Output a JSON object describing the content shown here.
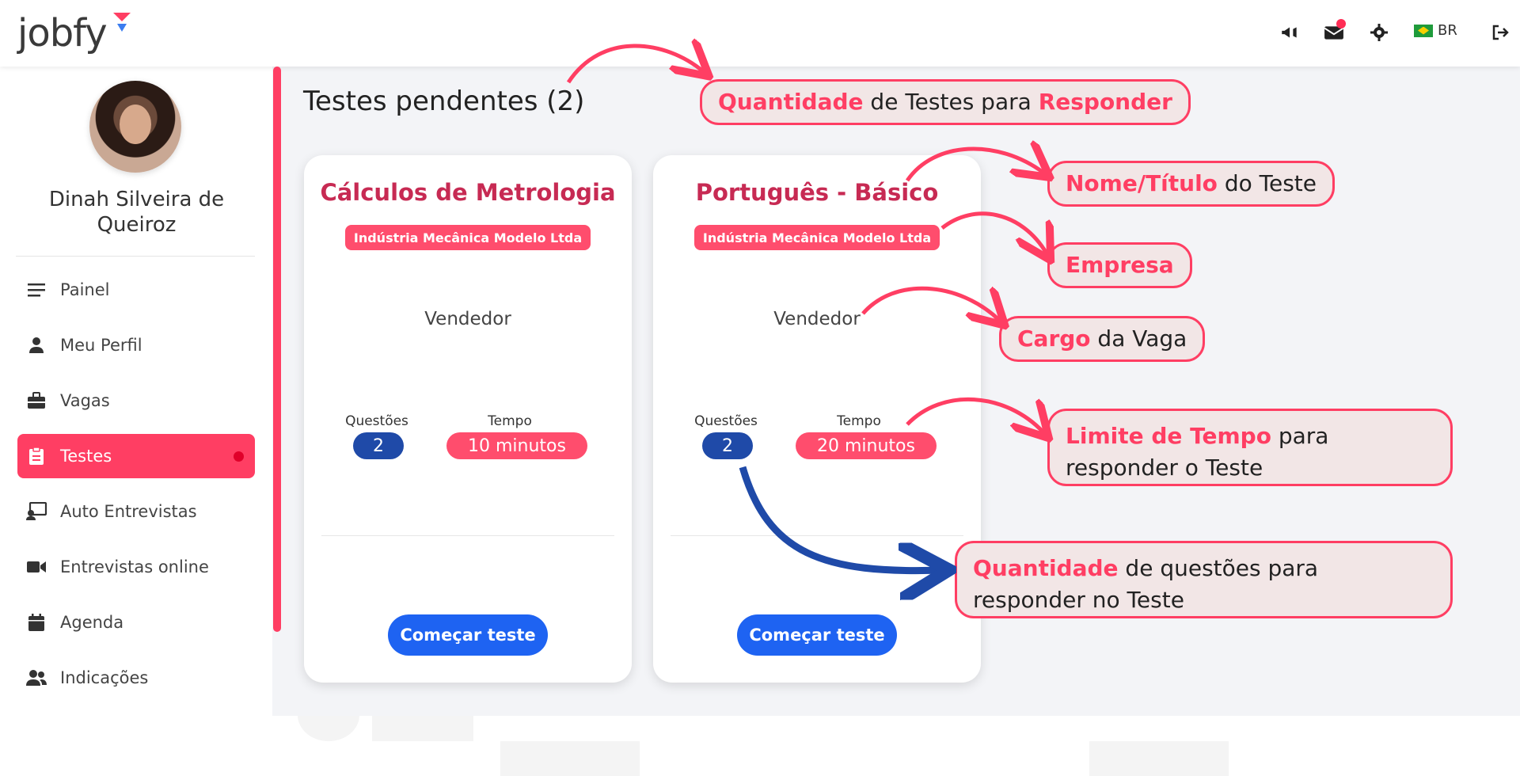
{
  "header": {
    "logo": "jobfy",
    "language": "BR"
  },
  "sidebar": {
    "user_name": "Dinah Silveira de Queiroz",
    "items": [
      {
        "label": "Painel",
        "icon": "menu-icon"
      },
      {
        "label": "Meu Perfil",
        "icon": "user-icon"
      },
      {
        "label": "Vagas",
        "icon": "briefcase-icon"
      },
      {
        "label": "Testes",
        "icon": "clipboard-icon",
        "active": true
      },
      {
        "label": "Auto Entrevistas",
        "icon": "presentation-icon"
      },
      {
        "label": "Entrevistas online",
        "icon": "video-icon"
      },
      {
        "label": "Agenda",
        "icon": "calendar-icon"
      },
      {
        "label": "Indicações",
        "icon": "users-icon"
      }
    ]
  },
  "main": {
    "title": "Testes pendentes (2)",
    "cards": [
      {
        "title": "Cálculos de Metrologia",
        "company": "Indústria Mecânica Modelo Ltda",
        "role": "Vendedor",
        "questions_label": "Questões",
        "questions": "2",
        "time_label": "Tempo",
        "time": "10 minutos",
        "button": "Começar teste"
      },
      {
        "title": "Português - Básico",
        "company": "Indústria Mecânica Modelo Ltda",
        "role": "Vendedor",
        "questions_label": "Questões",
        "questions": "2",
        "time_label": "Tempo",
        "time": "20 minutos",
        "button": "Começar teste"
      }
    ]
  },
  "annotations": [
    {
      "bold": "Quantidade",
      "text": " de Testes para ",
      "bold2": "Responder"
    },
    {
      "bold": "Nome/Título",
      "text": " do Teste"
    },
    {
      "bold": "Empresa",
      "text": ""
    },
    {
      "bold": "Cargo",
      "text": " da Vaga"
    },
    {
      "bold": "Limite de Tempo",
      "text": " para responder o Teste"
    },
    {
      "bold": "Quantidade",
      "text": " de questões para responder no Teste"
    }
  ],
  "colors": {
    "accent": "#ff3e63",
    "title_red": "#c72a53",
    "primary_blue": "#1e63f2",
    "pill_blue": "#1f4aa8",
    "background": "#f3f4f7"
  }
}
